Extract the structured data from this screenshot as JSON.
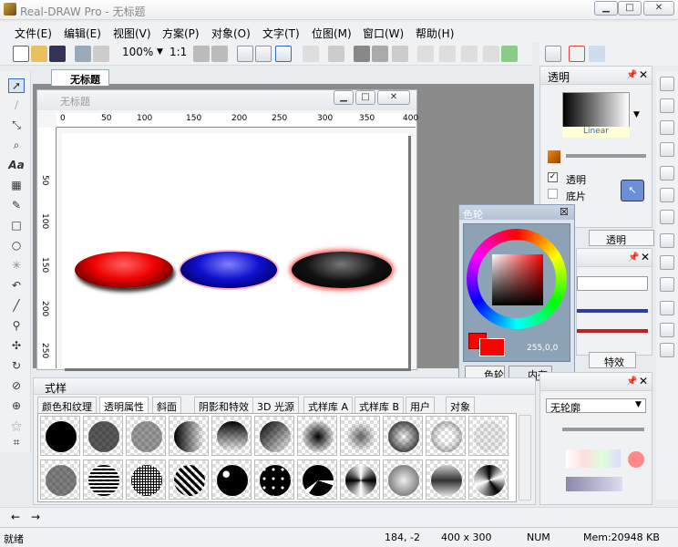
{
  "app": {
    "title": "Real-DRAW Pro - 无标题"
  },
  "menu": [
    "文件(E)",
    "编辑(E)",
    "视图(V)",
    "方案(P)",
    "对象(O)",
    "文字(T)",
    "位图(M)",
    "窗口(W)",
    "帮助(H)"
  ],
  "toolbar": {
    "zoom": "100%",
    "ratio": "1:1"
  },
  "document": {
    "tab": "无标题",
    "window_title": "无标题",
    "ruler_h": [
      "0",
      "50",
      "100",
      "150",
      "200",
      "250",
      "300",
      "350",
      "400"
    ],
    "ruler_v": [
      "50",
      "100",
      "150",
      "200",
      "250"
    ]
  },
  "transparency_panel": {
    "title": "透明",
    "gradient_label": "Linear",
    "checkbox1": "透明",
    "checkbox2": "底片",
    "tab": "透明"
  },
  "color_wheel": {
    "title": "色轮",
    "value": "255,0,0",
    "tab1": "色轮",
    "tab2": "内存"
  },
  "effects_panel": {
    "tab": "特效"
  },
  "style_panel": {
    "title": "式样",
    "tabs": [
      "颜色和纹理",
      "透明属性",
      "斜面",
      "阴影和特效",
      "3D 光源",
      "式样库 A",
      "式样库 B",
      "用户",
      "对象"
    ]
  },
  "outline_panel": {
    "dropdown": "无轮廓"
  },
  "status": {
    "ready": "就绪",
    "coords": "184, -2",
    "size": "400 x 300",
    "num": "NUM",
    "mem": "Mem:20948 KB"
  },
  "colors": {
    "accent": "#316ac5",
    "red": "#ff0000",
    "blue": "#0000ff"
  }
}
